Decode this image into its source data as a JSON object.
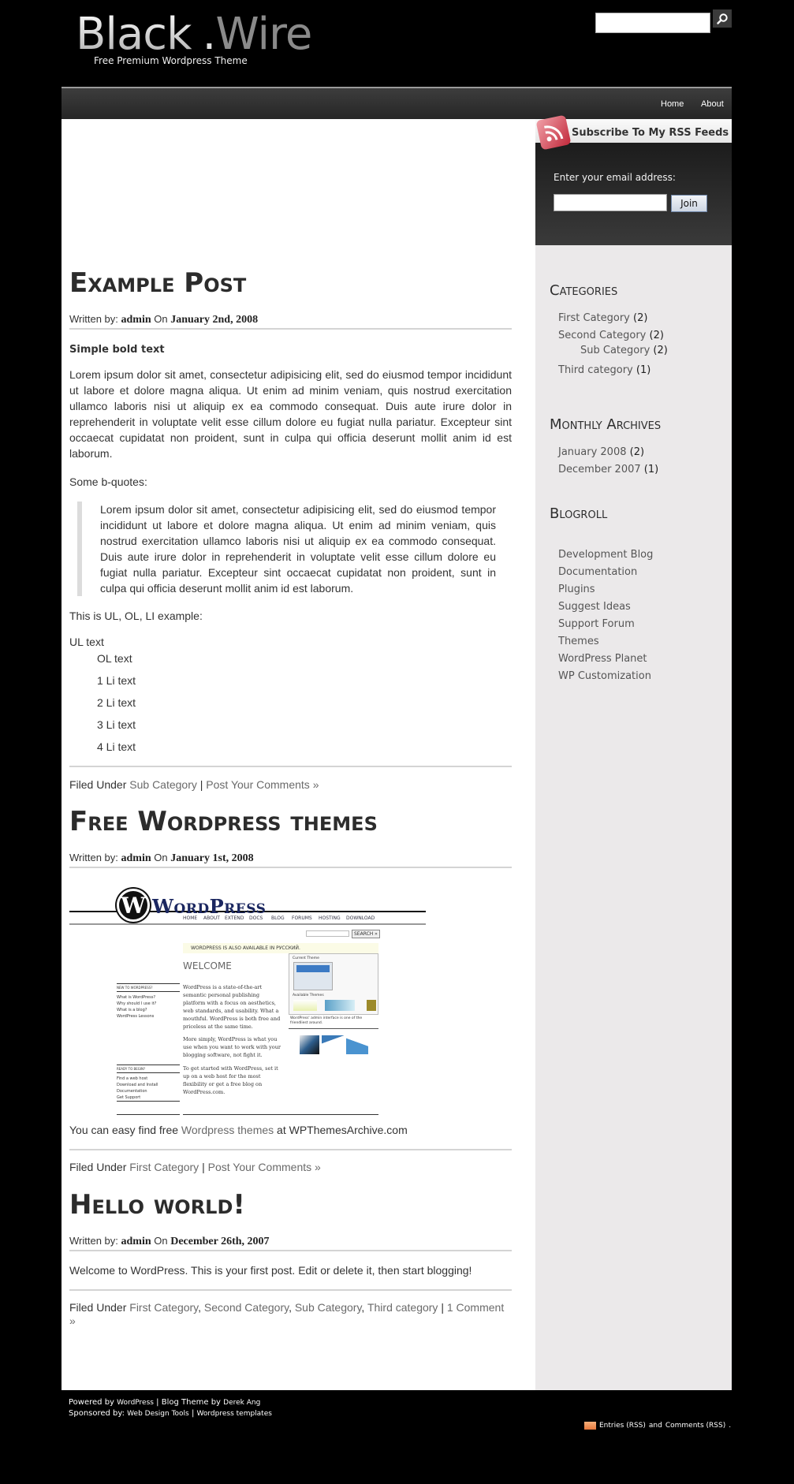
{
  "header": {
    "logo_part1": "Black",
    "logo_dot": ".",
    "logo_part2": "Wire",
    "tagline": "Free Premium Wordpress Theme",
    "search": {
      "value": "",
      "placeholder": "",
      "button_icon": "search-icon"
    }
  },
  "nav": {
    "items": [
      {
        "label": "Home"
      },
      {
        "label": "About"
      }
    ]
  },
  "posts": [
    {
      "title": "Example Post",
      "meta": {
        "written_by_label": "Written by:",
        "author": "admin",
        "on_label": "On",
        "date": "January 2nd, 2008"
      },
      "bold_heading": "Simple bold text",
      "paragraph": "Lorem ipsum dolor sit amet, consectetur adipisicing elit, sed do eiusmod tempor incididunt ut labore et dolore magna aliqua. Ut enim ad minim veniam, quis nostrud exercitation ullamco laboris nisi ut aliquip ex ea commodo consequat. Duis aute irure dolor in reprehenderit in voluptate velit esse cillum dolore eu fugiat nulla pariatur. Excepteur sint occaecat cupidatat non proident, sunt in culpa qui officia deserunt mollit anim id est laborum.",
      "bquote_intro": "Some b-quotes:",
      "blockquote": "Lorem ipsum dolor sit amet, consectetur adipisicing elit, sed do eiusmod tempor incididunt ut labore et dolore magna aliqua. Ut enim ad minim veniam, quis nostrud exercitation ullamco laboris nisi ut aliquip ex ea commodo consequat. Duis aute irure dolor in reprehenderit in voluptate velit esse cillum dolore eu fugiat nulla pariatur. Excepteur sint occaecat cupidatat non proident, sunt in culpa qui officia deserunt mollit anim id est laborum.",
      "list_intro": "This is UL, OL, LI example:",
      "ul_text": "UL text",
      "ol_text": "OL text",
      "li_items": [
        "1 Li text",
        "2 Li text",
        "3 Li text",
        "4 Li text"
      ],
      "filed_label": "Filed Under",
      "categories": [
        "Sub Category"
      ],
      "sep": "|",
      "comments_link": "Post Your Comments »"
    },
    {
      "title": "Free Wordpress themes",
      "meta": {
        "written_by_label": "Written by:",
        "author": "admin",
        "on_label": "On",
        "date": "January 1st, 2008"
      },
      "image": {
        "logo_text": "WordPress",
        "nav": [
          "HOME",
          "ABOUT",
          "EXTEND",
          "DOCS",
          "BLOG",
          "FORUMS",
          "HOSTING",
          "DOWNLOAD"
        ],
        "search_button": "SEARCH »",
        "notice": "WORDPRESS IS ALSO AVAILABLE IN РУССКИЙ.",
        "welcome": "WELCOME",
        "new_heading": "NEW TO WORDPRESS?",
        "new_links": [
          "What is WordPress?",
          "Why should I use it?",
          "What is a blog?",
          "WordPress Lessons"
        ],
        "ready_heading": "READY TO BEGIN?",
        "ready_links": [
          "Find a web host",
          "Download and Install",
          "Documentation",
          "Get Support"
        ],
        "body1": "WordPress is a state-of-the-art semantic personal publishing platform with a focus on aesthetics, web standards, and usability. What a mouthful. WordPress is both free and priceless at the same time.",
        "body2": "More simply, WordPress is what you use when you want to work with your blogging software, not fight it.",
        "body3": "To get started with WordPress, set it up on a web host for the most flexibility or get a free blog on WordPress.com.",
        "current_theme": "Current Theme",
        "available_themes": "Available Themes",
        "caption": "WordPress' admin interface is one of the friendliest around."
      },
      "text_before": "You can easy find free",
      "text_link": "Wordpress themes",
      "text_after": "at WPThemesArchive.com",
      "filed_label": "Filed Under",
      "categories": [
        "First Category"
      ],
      "sep": "|",
      "comments_link": "Post Your Comments »"
    },
    {
      "title": "Hello world!",
      "meta": {
        "written_by_label": "Written by:",
        "author": "admin",
        "on_label": "On",
        "date": "December 26th, 2007"
      },
      "paragraph": "Welcome to WordPress. This is your first post. Edit or delete it, then start blogging!",
      "filed_label": "Filed Under",
      "categories": [
        "First Category",
        "Second Category",
        "Sub Category",
        "Third category"
      ],
      "sep": "|",
      "comments_link": "1 Comment »"
    }
  ],
  "sidebar": {
    "subscribe": {
      "title": "Subscribe To My RSS Feeds",
      "email_label": "Enter your email address:",
      "email_value": "",
      "join_label": "Join"
    },
    "categories": {
      "title": "Categories",
      "items": [
        {
          "label": "First Category",
          "count": "(2)"
        },
        {
          "label": "Second Category",
          "count": "(2)"
        },
        {
          "label": "Sub Category",
          "count": "(2)"
        },
        {
          "label": "Third category",
          "count": "(1)"
        }
      ]
    },
    "archives": {
      "title": "Monthly Archives",
      "items": [
        {
          "label": "January 2008",
          "count": "(2)"
        },
        {
          "label": "December 2007",
          "count": "(1)"
        }
      ]
    },
    "blogroll": {
      "title": "Blogroll",
      "items": [
        "Development Blog",
        "Documentation",
        "Plugins",
        "Suggest Ideas",
        "Support Forum",
        "Themes",
        "WordPress Planet",
        "WP Customization"
      ]
    }
  },
  "footer": {
    "powered_label": "Powered by",
    "powered_link": "WordPress",
    "sep": "|",
    "theme_label": "Blog Theme by",
    "theme_author": "Derek Ang",
    "sponsored_label": "Sponsored by:",
    "sponsor1": "Web Design Tools",
    "sponsor2": "Wordpress templates",
    "entries_rss": "Entries (RSS)",
    "and_label": "and",
    "comments_rss": "Comments (RSS)",
    "end": "."
  },
  "colors": {
    "page_bg": "#000000",
    "content_bg": "#ffffff",
    "sidebar_bg": "#ebe9ea",
    "link_gray": "#6a6a6a",
    "rss_red": "#c2283a"
  }
}
